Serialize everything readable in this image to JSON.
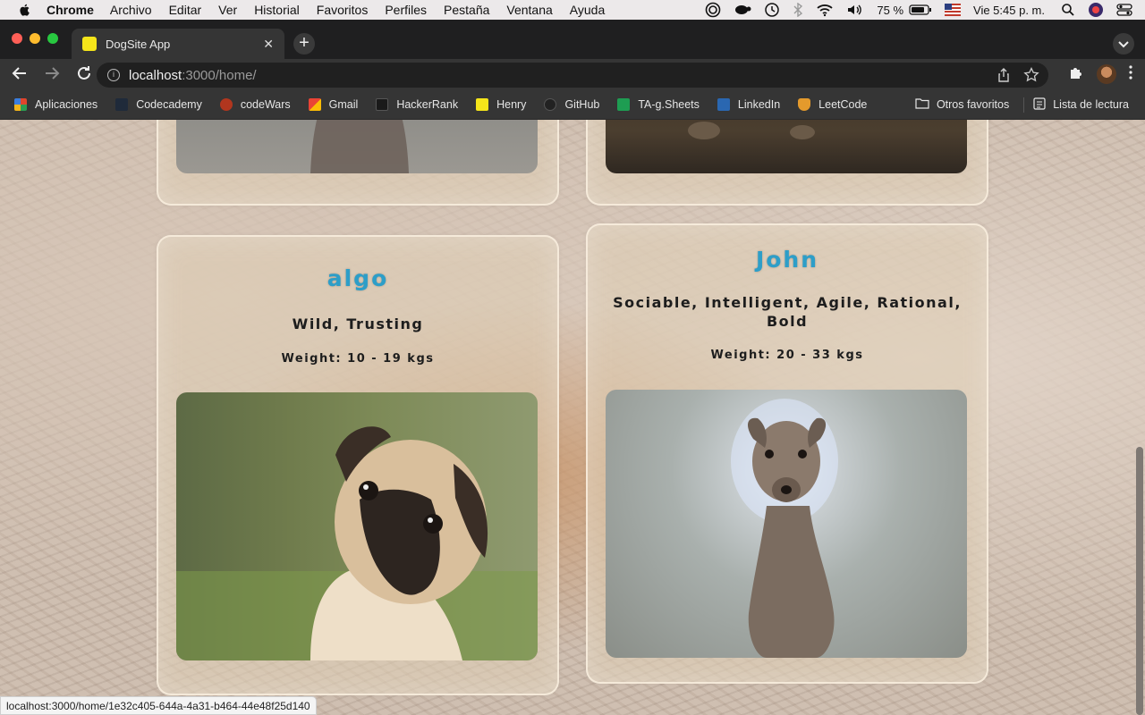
{
  "menubar": {
    "app_name": "Chrome",
    "items": [
      "Archivo",
      "Editar",
      "Ver",
      "Historial",
      "Favoritos",
      "Perfiles",
      "Pestaña",
      "Ventana",
      "Ayuda"
    ],
    "battery": "75 %",
    "clock": "Vie 5:45 p. m."
  },
  "browser": {
    "tab_title": "DogSite App",
    "url_host": "localhost",
    "url_path": ":3000/home/",
    "bookmarks": [
      {
        "label": "Aplicaciones",
        "icon": "apps-grid-icon",
        "color": "#e0452c"
      },
      {
        "label": "Codecademy",
        "icon": "codecademy-icon",
        "color": "#1f2a3a"
      },
      {
        "label": "codeWars",
        "icon": "codewars-icon",
        "color": "#b1361e"
      },
      {
        "label": "Gmail",
        "icon": "gmail-icon",
        "color": "#ea4335"
      },
      {
        "label": "HackerRank",
        "icon": "hackerrank-icon",
        "color": "#1a1a1a"
      },
      {
        "label": "Henry",
        "icon": "henry-icon",
        "color": "#f5e51a"
      },
      {
        "label": "GitHub",
        "icon": "github-icon",
        "color": "#222222"
      },
      {
        "label": "TA-g.Sheets",
        "icon": "sheets-icon",
        "color": "#1e9d52"
      },
      {
        "label": "LinkedIn",
        "icon": "linkedin-icon",
        "color": "#2a67b1"
      },
      {
        "label": "LeetCode",
        "icon": "leetcode-icon",
        "color": "#e49a2c"
      }
    ],
    "other_favorites": "Otros favoritos",
    "reading_list": "Lista de lectura",
    "status_url": "localhost:3000/home/1e32c405-644a-4a31-b464-44e48f25d140"
  },
  "cards": [
    {
      "name": "algo",
      "temperament": "Wild, Trusting",
      "weight": "Weight: 10 - 19 kgs",
      "photo": "pug-photo"
    },
    {
      "name": "John",
      "temperament": "Sociable, Intelligent, Agile, Rational, Bold",
      "weight": "Weight: 20 - 33 kgs",
      "photo": "greyhound-photo"
    }
  ],
  "colors": {
    "dog_name": "#2d9ec8",
    "card_border": "#faf0e1",
    "chrome_dark": "#353535"
  }
}
